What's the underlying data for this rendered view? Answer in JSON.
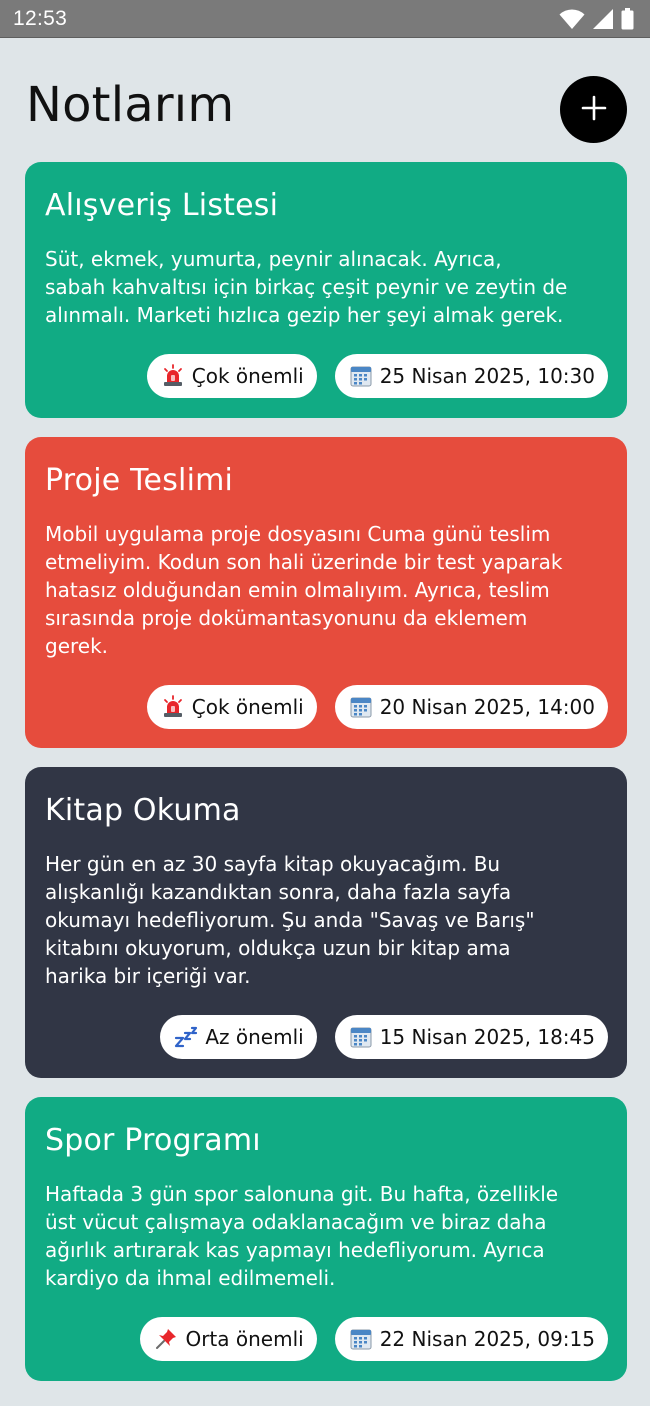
{
  "status_bar": {
    "time": "12:53",
    "icons": [
      "wifi-icon",
      "signal-icon",
      "battery-icon"
    ]
  },
  "header": {
    "title": "Notlarım",
    "add_icon": "plus-icon"
  },
  "colors": {
    "background": "#dfe5e8",
    "green": "#11ab84",
    "red": "#e64c3d",
    "dark": "#313645"
  },
  "notes": [
    {
      "title": "Alışveriş Listesi",
      "body": "Süt, ekmek, yumurta, peynir alınacak. Ayrıca,\nsabah kahvaltısı için birkaç çeşit peynir ve zeytin de\nalınmalı. Marketi hızlıca gezip her şeyi almak gerek.",
      "priority": "Çok önemli",
      "priority_icon": "siren-icon",
      "date": "25 Nisan 2025, 10:30",
      "date_icon": "calendar-icon",
      "color": "#11ab84"
    },
    {
      "title": "Proje Teslimi",
      "body": "Mobil uygulama proje dosyasını Cuma günü teslim\netmeliyim. Kodun son hali üzerinde bir test yaparak\nhatasız olduğundan emin olmalıyım. Ayrıca, teslim\nsırasında proje dokümantasyonunu da eklemem\ngerek.",
      "priority": "Çok önemli",
      "priority_icon": "siren-icon",
      "date": "20 Nisan 2025, 14:00",
      "date_icon": "calendar-icon",
      "color": "#e64c3d"
    },
    {
      "title": "Kitap Okuma",
      "body": "Her gün en az 30 sayfa kitap okuyacağım. Bu\nalışkanlığı kazandıktan sonra, daha fazla sayfa\nokumayı hedefliyorum. Şu anda \"Savaş ve Barış\"\nkitabını okuyorum, oldukça uzun bir kitap ama\nharika bir içeriği var.",
      "priority": "Az önemli",
      "priority_icon": "zzz-icon",
      "date": "15 Nisan 2025, 18:45",
      "date_icon": "calendar-icon",
      "color": "#313645"
    },
    {
      "title": "Spor Programı",
      "body": "Haftada 3 gün spor salonuna git. Bu hafta, özellikle\nüst vücut çalışmaya odaklanacağım ve biraz daha\nağırlık artırarak kas yapmayı hedefliyorum. Ayrıca\nkardiyo da ihmal edilmemeli.",
      "priority": "Orta önemli",
      "priority_icon": "pushpin-icon",
      "date": "22 Nisan 2025, 09:15",
      "date_icon": "calendar-icon",
      "color": "#11ab84"
    }
  ]
}
